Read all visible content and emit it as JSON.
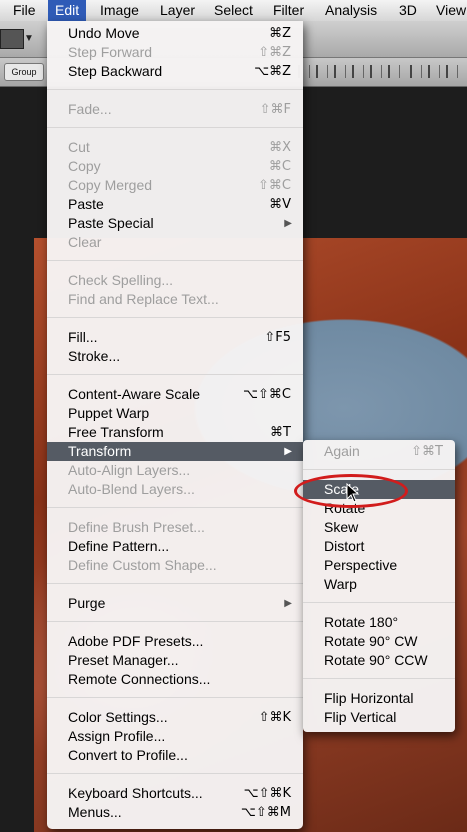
{
  "menubar": {
    "items": [
      {
        "label": "File"
      },
      {
        "label": "Edit"
      },
      {
        "label": "Image"
      },
      {
        "label": "Layer"
      },
      {
        "label": "Select"
      },
      {
        "label": "Filter"
      },
      {
        "label": "Analysis"
      },
      {
        "label": "3D"
      },
      {
        "label": "View"
      }
    ]
  },
  "toolbar": {
    "group_label": "Group"
  },
  "edit_menu": {
    "items": [
      {
        "label": "Undo Move",
        "shortcut": "⌘Z"
      },
      {
        "label": "Step Forward",
        "shortcut": "⇧⌘Z"
      },
      {
        "label": "Step Backward",
        "shortcut": "⌥⌘Z"
      },
      {
        "label": "Fade...",
        "shortcut": "⇧⌘F"
      },
      {
        "label": "Cut",
        "shortcut": "⌘X"
      },
      {
        "label": "Copy",
        "shortcut": "⌘C"
      },
      {
        "label": "Copy Merged",
        "shortcut": "⇧⌘C"
      },
      {
        "label": "Paste",
        "shortcut": "⌘V"
      },
      {
        "label": "Paste Special",
        "shortcut": ""
      },
      {
        "label": "Clear",
        "shortcut": ""
      },
      {
        "label": "Check Spelling...",
        "shortcut": ""
      },
      {
        "label": "Find and Replace Text...",
        "shortcut": ""
      },
      {
        "label": "Fill...",
        "shortcut": "⇧F5"
      },
      {
        "label": "Stroke...",
        "shortcut": ""
      },
      {
        "label": "Content-Aware Scale",
        "shortcut": "⌥⇧⌘C"
      },
      {
        "label": "Puppet Warp",
        "shortcut": ""
      },
      {
        "label": "Free Transform",
        "shortcut": "⌘T"
      },
      {
        "label": "Transform",
        "shortcut": ""
      },
      {
        "label": "Auto-Align Layers...",
        "shortcut": ""
      },
      {
        "label": "Auto-Blend Layers...",
        "shortcut": ""
      },
      {
        "label": "Define Brush Preset...",
        "shortcut": ""
      },
      {
        "label": "Define Pattern...",
        "shortcut": ""
      },
      {
        "label": "Define Custom Shape...",
        "shortcut": ""
      },
      {
        "label": "Purge",
        "shortcut": ""
      },
      {
        "label": "Adobe PDF Presets...",
        "shortcut": ""
      },
      {
        "label": "Preset Manager...",
        "shortcut": ""
      },
      {
        "label": "Remote Connections...",
        "shortcut": ""
      },
      {
        "label": "Color Settings...",
        "shortcut": "⇧⌘K"
      },
      {
        "label": "Assign Profile...",
        "shortcut": ""
      },
      {
        "label": "Convert to Profile...",
        "shortcut": ""
      },
      {
        "label": "Keyboard Shortcuts...",
        "shortcut": "⌥⇧⌘K"
      },
      {
        "label": "Menus...",
        "shortcut": "⌥⇧⌘M"
      }
    ]
  },
  "transform_submenu": {
    "items": [
      {
        "label": "Again",
        "shortcut": "⇧⌘T"
      },
      {
        "label": "Scale",
        "shortcut": ""
      },
      {
        "label": "Rotate",
        "shortcut": ""
      },
      {
        "label": "Skew",
        "shortcut": ""
      },
      {
        "label": "Distort",
        "shortcut": ""
      },
      {
        "label": "Perspective",
        "shortcut": ""
      },
      {
        "label": "Warp",
        "shortcut": ""
      },
      {
        "label": "Rotate 180°",
        "shortcut": ""
      },
      {
        "label": "Rotate 90° CW",
        "shortcut": ""
      },
      {
        "label": "Rotate 90° CCW",
        "shortcut": ""
      },
      {
        "label": "Flip Horizontal",
        "shortcut": ""
      },
      {
        "label": "Flip Vertical",
        "shortcut": ""
      }
    ]
  },
  "colors": {
    "menubar_highlight": "#2f5bb7",
    "menu_highlight": "#555b64",
    "annotation_circle": "#d11c1c"
  }
}
